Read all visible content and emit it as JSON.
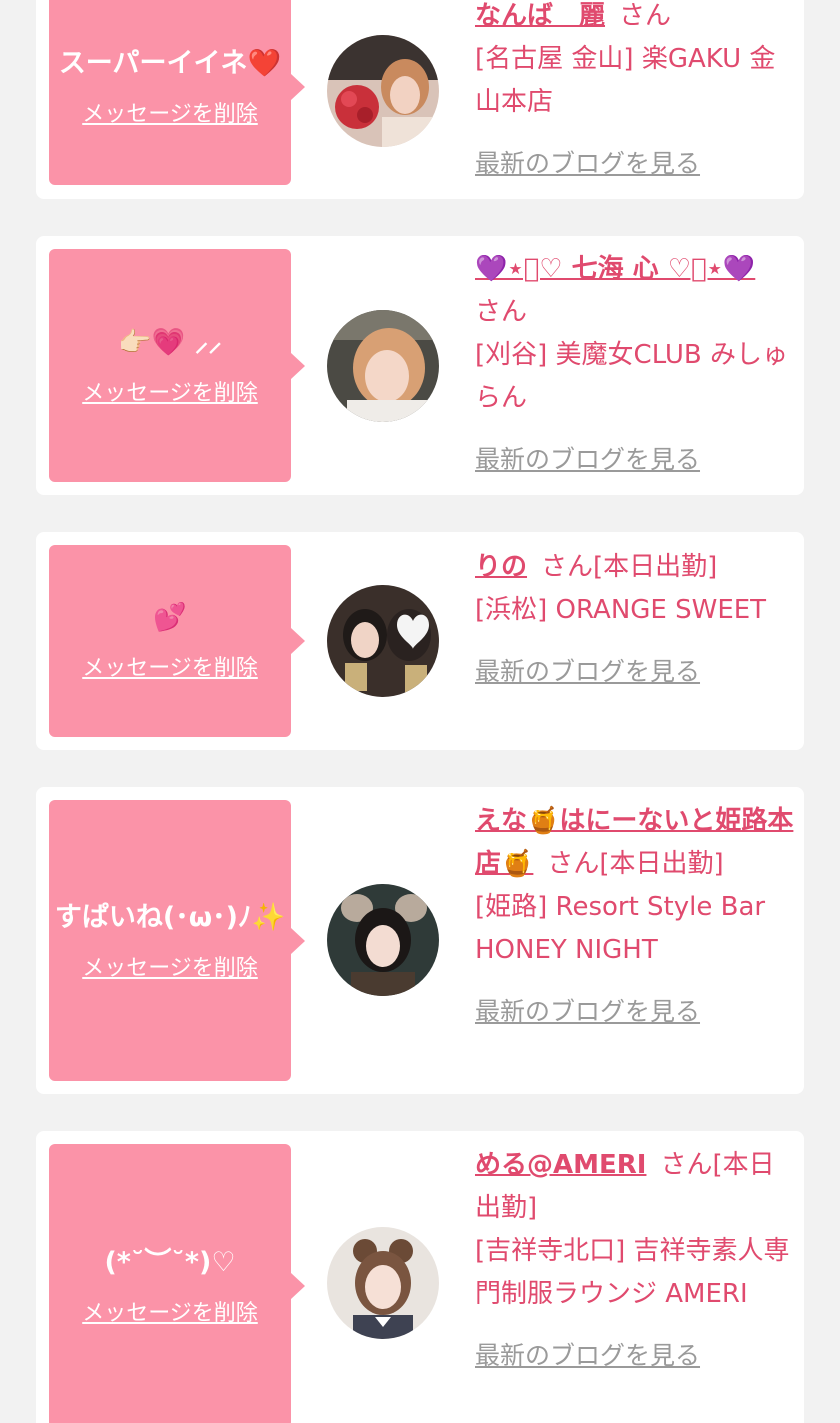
{
  "colors": {
    "page_bg": "#f2f2f2",
    "card_bg": "#ffffff",
    "bubble_bg": "#fb93a8",
    "accent_pink": "#e04a6e",
    "link_gray": "#9a9a9a"
  },
  "honorific": "さん",
  "delete_label": "メッセージを削除",
  "blog_label": "最新のブログを見る",
  "items": [
    {
      "message": "スーパーイイネ❤️",
      "name": "なんば　麗",
      "status": "",
      "shop": "[名古屋 金山] 楽GAKU 金山本店",
      "avatar_icon": "girl-portrait-with-bouquet"
    },
    {
      "message": "👉🏻💗 ⸝⸝",
      "name": "💜⋆͛♡ 七海 心 ♡⸝⋆💜",
      "status": "",
      "shop": "[刈谷] 美魔女CLUB みしゅらん",
      "avatar_icon": "girl-portrait-selfie"
    },
    {
      "message": "💕",
      "name": "りの",
      "status": "[本日出勤]",
      "shop": "[浜松] ORANGE SWEET",
      "avatar_icon": "two-girls-portrait"
    },
    {
      "message": "すぱいね(･ω･)ﾉ✨",
      "name": "えな🍯はにーないと姫路本店🍯",
      "status": "[本日出勤]",
      "shop": "[姫路] Resort Style Bar HONEY NIGHT",
      "avatar_icon": "girl-portrait-cat-ears"
    },
    {
      "message": "(*˘︶˘*)♡",
      "name": "める@AMERI",
      "status": "[本日出勤]",
      "shop": "[吉祥寺北口] 吉祥寺素人専門制服ラウンジ AMERI",
      "avatar_icon": "girl-portrait-uniform"
    }
  ]
}
